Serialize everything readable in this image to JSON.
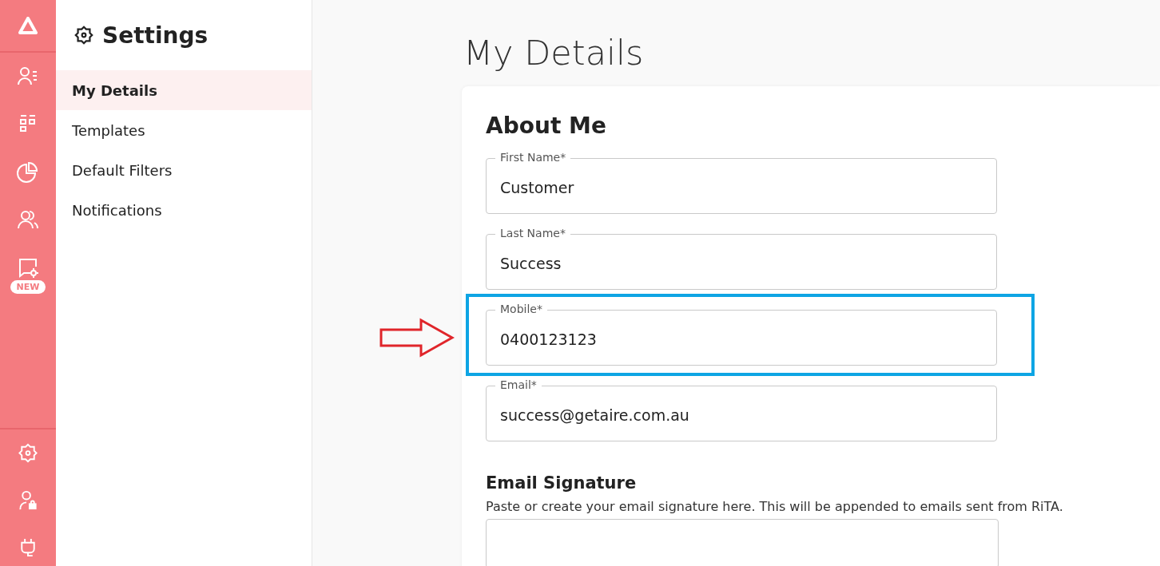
{
  "rail": {
    "badge": "NEW"
  },
  "settings": {
    "title": "Settings",
    "items": [
      {
        "label": "My Details",
        "selected": true
      },
      {
        "label": "Templates",
        "selected": false
      },
      {
        "label": "Default Filters",
        "selected": false
      },
      {
        "label": "Notifications",
        "selected": false
      }
    ]
  },
  "page": {
    "title": "My Details"
  },
  "about": {
    "heading": "About Me",
    "fields": [
      {
        "label": "First Name*",
        "value": "Customer",
        "highlighted": false
      },
      {
        "label": "Last Name*",
        "value": "Success",
        "highlighted": false
      },
      {
        "label": "Mobile*",
        "value": "0400123123",
        "highlighted": true
      },
      {
        "label": "Email*",
        "value": "success@getaire.com.au",
        "highlighted": false
      }
    ]
  },
  "signature": {
    "heading": "Email Signature",
    "description": "Paste or create your email signature here. This will be appended to emails sent from RiTA."
  }
}
